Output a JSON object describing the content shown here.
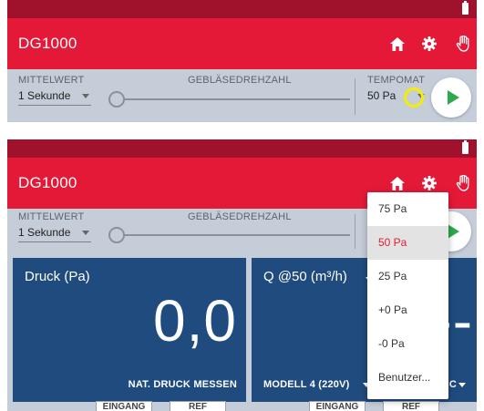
{
  "top": {
    "app_title": "DG1000",
    "mittelwert_label": "MITTELWERT",
    "mittelwert_value": "1 Sekunde",
    "geblaese_label": "GEBLÄSEDREHZAHL",
    "tempomat_label": "TEMPOMAT",
    "tempomat_value": "50 Pa"
  },
  "bottom": {
    "app_title": "DG1000",
    "mittelwert_label": "MITTELWERT",
    "mittelwert_value": "1 Sekunde",
    "geblaese_label": "GEBLÄSEDREHZAHL",
    "card_left": {
      "title": "Druck (Pa)",
      "value": "0,0",
      "footer": "NAT. DRUCK MESSEN"
    },
    "card_right": {
      "title": "Q @50 (m³/h)",
      "value": "--",
      "footer_model": "MODELL 4 (220V)",
      "footer_partial": "E C"
    },
    "tabs": [
      "EINGANG",
      "REF",
      "EINGANG",
      "REF"
    ],
    "dropdown": {
      "items": [
        "75 Pa",
        "50 Pa",
        "25 Pa",
        "+0 Pa",
        "-0 Pa",
        "Benutzer..."
      ],
      "selected": "50 Pa"
    }
  },
  "colors": {
    "status_bar": "#a0122b",
    "app_bar": "#e31937",
    "controls_bg": "#c5cdd9",
    "card": "#1f4b7e",
    "play": "#2ea94b",
    "highlight_ring": "#f4ee00"
  },
  "icons": [
    "battery-icon",
    "home-icon",
    "gear-icon",
    "hand-icon",
    "play-icon",
    "chevron-down-icon"
  ]
}
